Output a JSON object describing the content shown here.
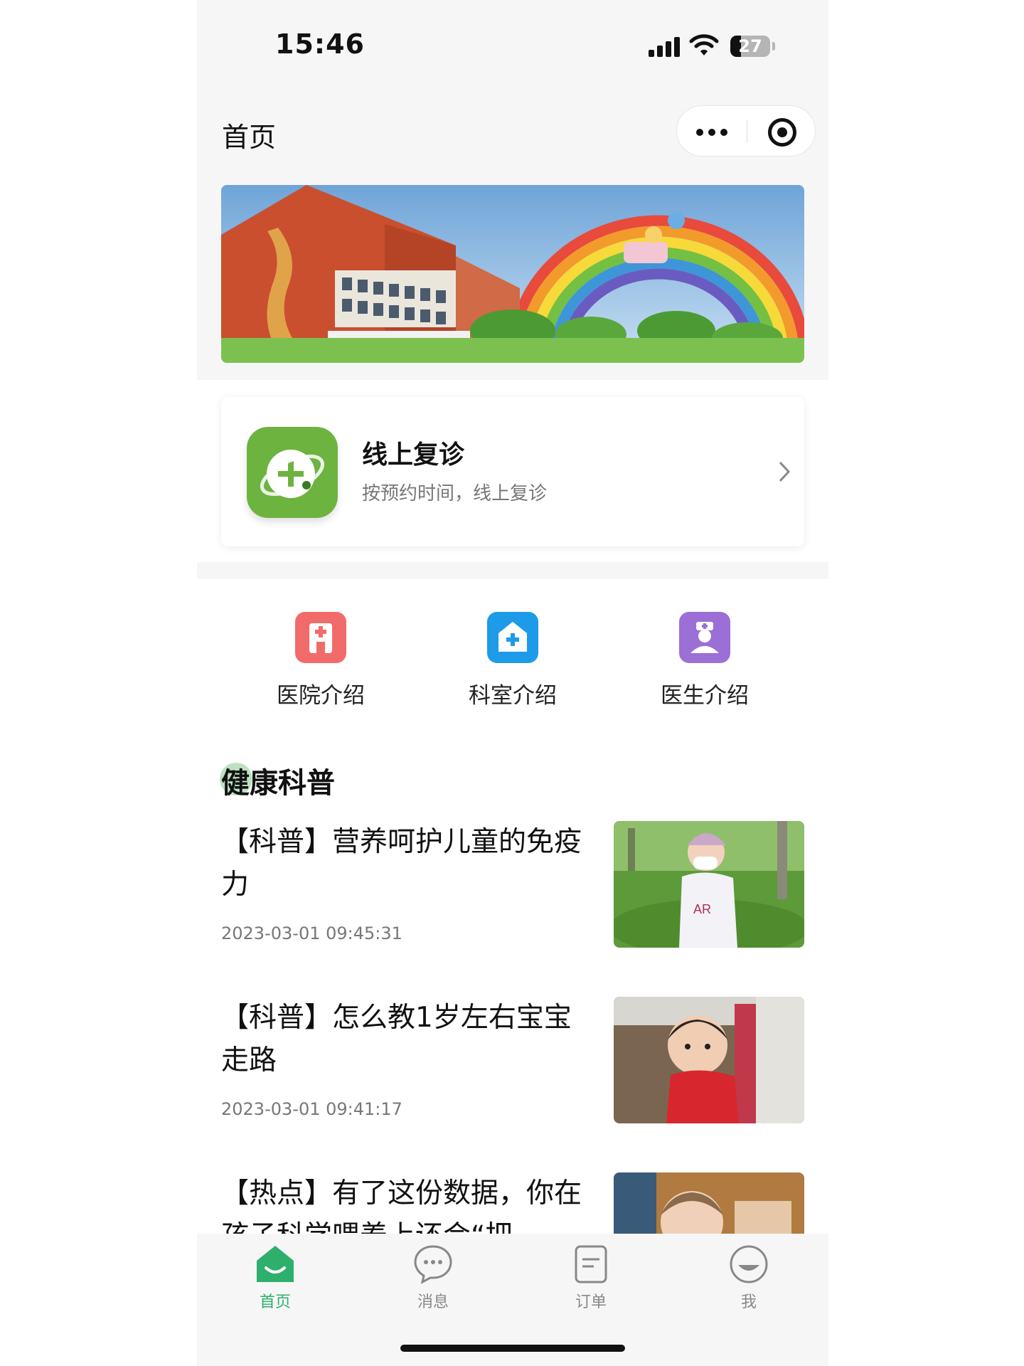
{
  "status_bar": {
    "time": "15:46",
    "battery": "27"
  },
  "nav": {
    "title": "首页"
  },
  "online_visit": {
    "title": "线上复诊",
    "subtitle": "按预约时间，线上复诊"
  },
  "entries": [
    {
      "label": "医院介绍",
      "icon": "hospital-icon",
      "color": "#f26b6b"
    },
    {
      "label": "科室介绍",
      "icon": "department-icon",
      "color": "#1e9be8"
    },
    {
      "label": "医生介绍",
      "icon": "doctor-icon",
      "color": "#9b6fd6"
    }
  ],
  "section": {
    "title": "健康科普"
  },
  "articles": [
    {
      "title": "【科普】营养呵护儿童的免疫力",
      "date": "2023-03-01 09:45:31"
    },
    {
      "title": "【科普】怎么教1岁左右宝宝走路",
      "date": "2023-03-01 09:41:17"
    },
    {
      "title": "【热点】有了这份数据，你在孩子科学喂养上还会“把",
      "date": ""
    }
  ],
  "tabbar": [
    {
      "label": "首页",
      "icon": "home-icon",
      "active": true
    },
    {
      "label": "消息",
      "icon": "message-icon",
      "active": false
    },
    {
      "label": "订单",
      "icon": "order-icon",
      "active": false
    },
    {
      "label": "我",
      "icon": "profile-icon",
      "active": false
    }
  ],
  "colors": {
    "accent": "#2eaf6c",
    "online_icon": "#6db33f"
  }
}
